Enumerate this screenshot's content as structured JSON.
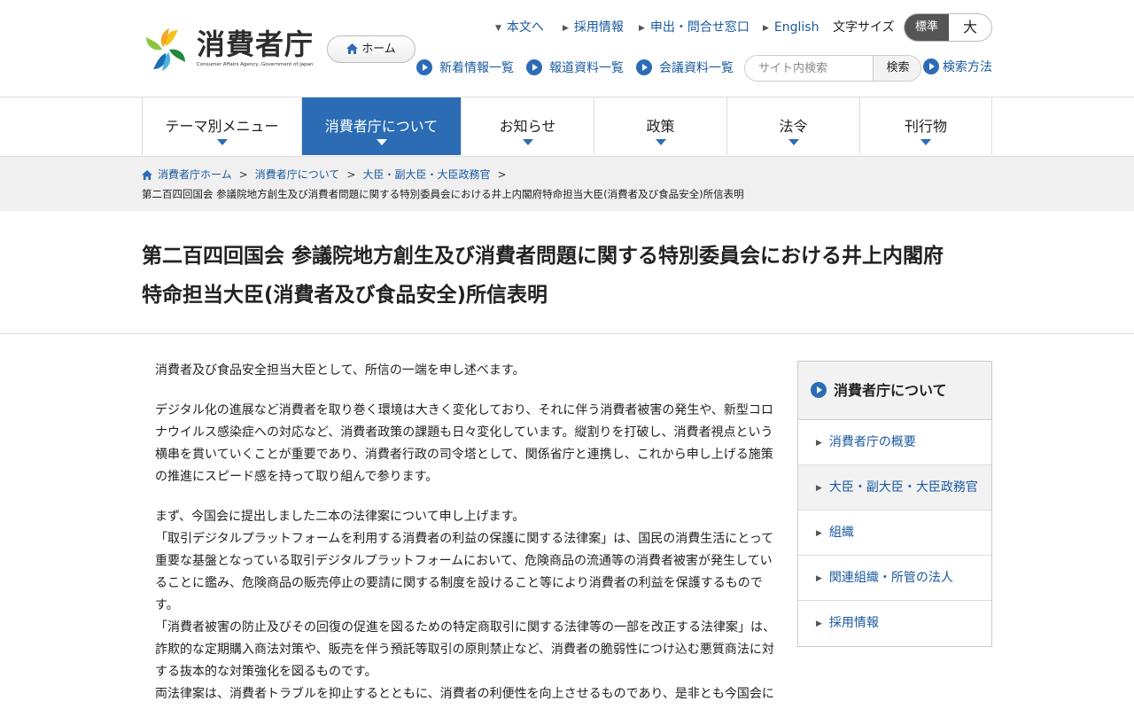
{
  "header": {
    "logo_title": "消費者庁",
    "logo_sub": "Consumer Affairs Agency, Government of Japan",
    "home_label": "ホーム",
    "top_links": [
      "本文へ",
      "採用情報",
      "申出・問合せ窓口",
      "English"
    ],
    "font_size_label": "文字サイズ",
    "font_size_options": [
      "標準",
      "大"
    ],
    "sub_links": [
      "新着情報一覧",
      "報道資料一覧",
      "会議資料一覧"
    ],
    "search_placeholder": "サイト内検索",
    "search_button": "検索",
    "search_help": "検索方法"
  },
  "gnav": [
    "テーマ別メニュー",
    "消費者庁について",
    "お知らせ",
    "政策",
    "法令",
    "刊行物"
  ],
  "breadcrumb": {
    "items": [
      "消費者庁ホーム",
      "消費者庁について",
      "大臣・副大臣・大臣政務官"
    ],
    "current": "第二百四回国会 参議院地方創生及び消費者問題に関する特別委員会における井上内閣府特命担当大臣(消費者及び食品安全)所信表明"
  },
  "page_title_line1": "第二百四回国会 参議院地方創生及び消費者問題に関する特別委員会における井上内閣府",
  "page_title_line2": "特命担当大臣(消費者及び食品安全)所信表明",
  "body": {
    "p1": "消費者及び食品安全担当大臣として、所信の一端を申し述べます。",
    "p2": "デジタル化の進展など消費者を取り巻く環境は大きく変化しており、それに伴う消費者被害の発生や、新型コロナウイルス感染症への対応など、消費者政策の課題も日々変化しています。縦割りを打破し、消費者視点という横串を貫いていくことが重要であり、消費者行政の司令塔として、関係省庁と連携し、これから申し上げる施策の推進にスピード感を持って取り組んで参ります。",
    "p3a": "まず、今国会に提出しました二本の法律案について申し上げます。",
    "p3b": "「取引デジタルプラットフォームを利用する消費者の利益の保護に関する法律案」は、国民の消費生活にとって重要な基盤となっている取引デジタルプラットフォームにおいて、危険商品の流通等の消費者被害が発生していることに鑑み、危険商品の販売停止の要請に関する制度を設けること等により消費者の利益を保護するものです。",
    "p3c": "「消費者被害の防止及びその回復の促進を図るための特定商取引に関する法律等の一部を改正する法律案」は、詐欺的な定期購入商法対策や、販売を伴う預託等取引の原則禁止など、消費者の脆弱性につけ込む悪質商法に対する抜本的な対策強化を図るものです。",
    "p3d": "両法律案は、消費者トラブルを抑止するとともに、消費者の利便性を向上させるものであり、是非とも今国会に"
  },
  "sidenav": {
    "heading": "消費者庁について",
    "items": [
      "消費者庁の概要",
      "大臣・副大臣・大臣政務官",
      "組織",
      "関連組織・所管の法人",
      "採用情報"
    ]
  },
  "colors": {
    "accent": "#2b6cb5",
    "link": "#1a5aa0",
    "font_switch_active": "#555555"
  }
}
